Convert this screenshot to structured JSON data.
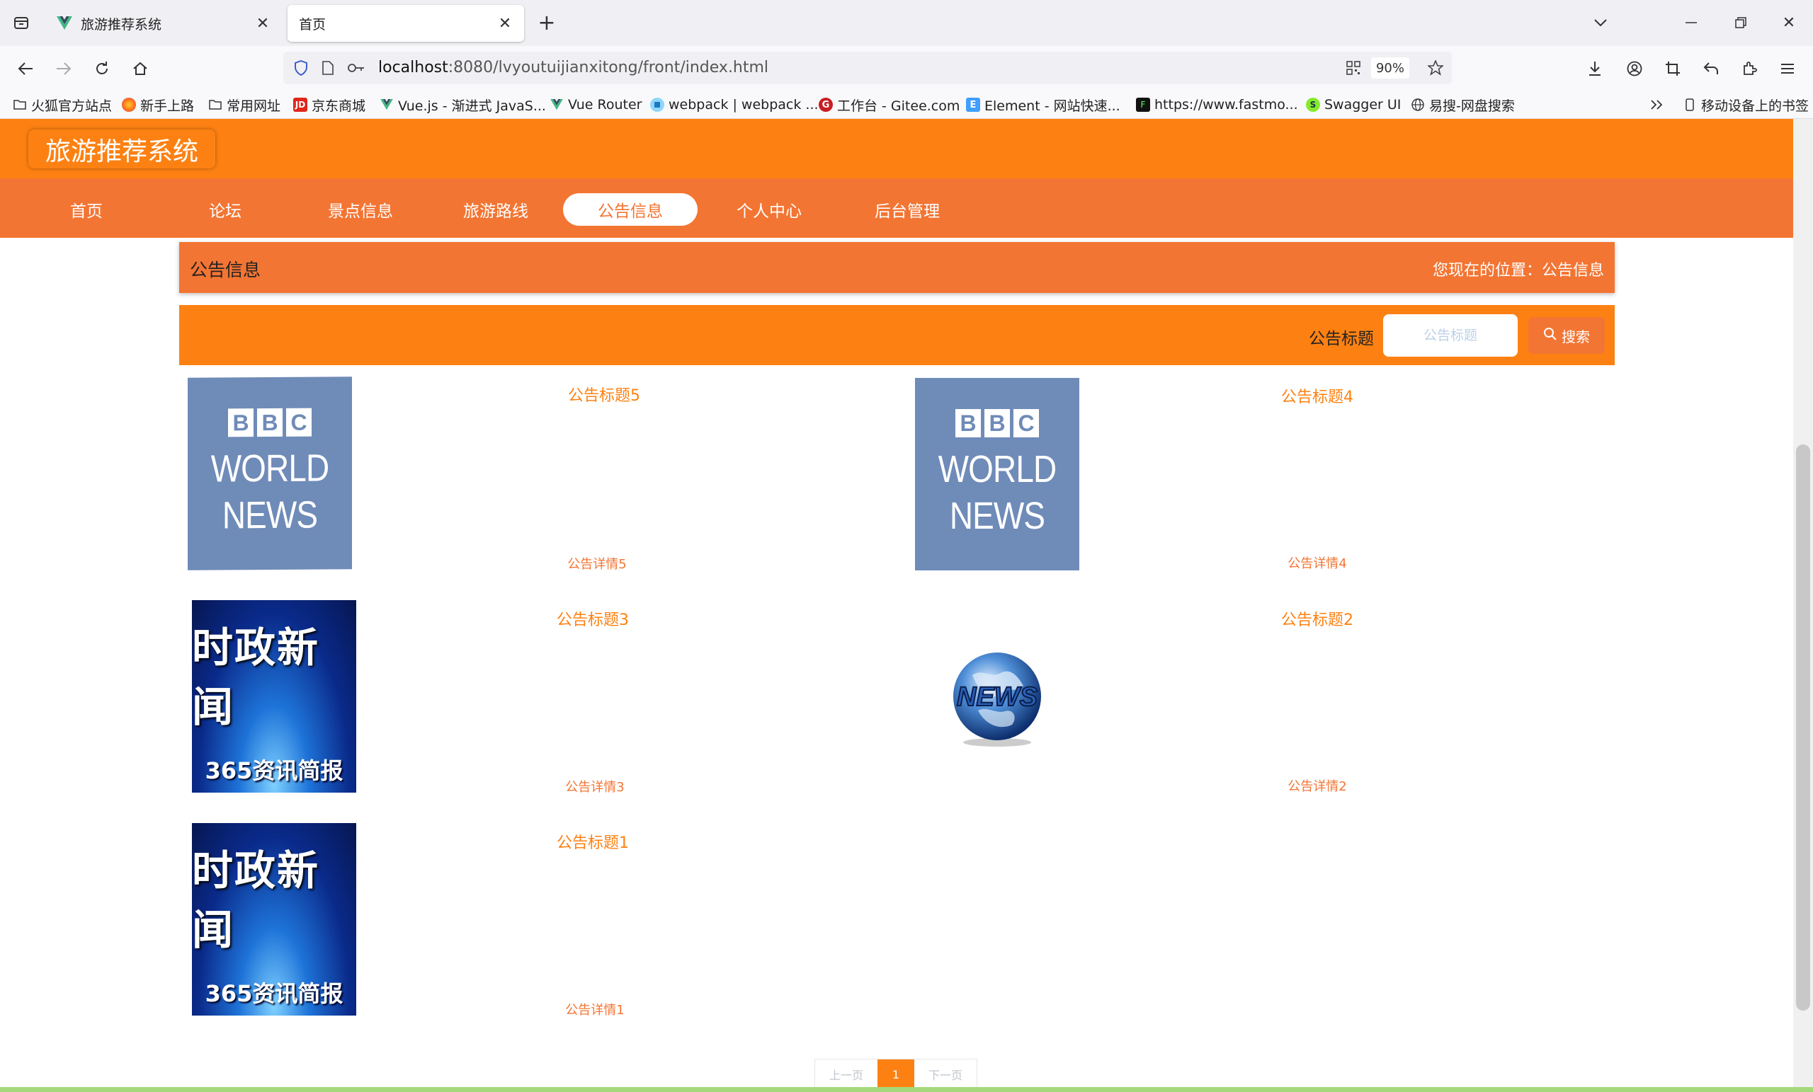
{
  "browser": {
    "tabs": [
      {
        "title": "旅游推荐系统",
        "active": false
      },
      {
        "title": "首页",
        "active": true
      }
    ],
    "url_host": "localhost",
    "url_rest": ":8080/lvyoutuijianxitong/front/index.html",
    "zoom": "90%",
    "bookmarks": [
      {
        "label": "火狐官方站点",
        "icon": "folder-icon"
      },
      {
        "label": "新手上路",
        "icon": "firefox-icon"
      },
      {
        "label": "常用网址",
        "icon": "folder-icon"
      },
      {
        "label": "京东商城",
        "icon": "jd-icon"
      },
      {
        "label": "Vue.js - 渐进式 JavaS...",
        "icon": "vue-icon"
      },
      {
        "label": "Vue Router",
        "icon": "vue-icon"
      },
      {
        "label": "webpack | webpack ...",
        "icon": "webpack-icon"
      },
      {
        "label": "工作台 - Gitee.com",
        "icon": "gitee-icon"
      },
      {
        "label": "Element - 网站快速...",
        "icon": "element-icon"
      },
      {
        "label": "https://www.fastmo...",
        "icon": "fastmock-icon"
      },
      {
        "label": "Swagger UI",
        "icon": "swagger-icon"
      },
      {
        "label": "易搜-网盘搜索",
        "icon": "globe-icon"
      }
    ],
    "mobile_bookmarks": "移动设备上的书签"
  },
  "site": {
    "logo": "旅游推荐系统",
    "nav": [
      "首页",
      "论坛",
      "景点信息",
      "旅游路线",
      "公告信息",
      "个人中心",
      "后台管理"
    ],
    "active_nav": "公告信息"
  },
  "breadcrumb": {
    "title": "公告信息",
    "location_label": "您现在的位置：",
    "location_value": "公告信息"
  },
  "search": {
    "label": "公告标题",
    "placeholder": "公告标题",
    "button": "搜索"
  },
  "notices": [
    {
      "title": "公告标题5",
      "detail": "公告详情5",
      "image": "bbc-world-news"
    },
    {
      "title": "公告标题4",
      "detail": "公告详情4",
      "image": "bbc-world-news"
    },
    {
      "title": "公告标题3",
      "detail": "公告详情3",
      "image": "shizheng-news"
    },
    {
      "title": "公告标题2",
      "detail": "公告详情2",
      "image": "news-globe"
    },
    {
      "title": "公告标题1",
      "detail": "公告详情1",
      "image": "shizheng-news"
    }
  ],
  "image_text": {
    "bbc_letters": [
      "B",
      "B",
      "C"
    ],
    "bbc_line1": "WORLD",
    "bbc_line2": "NEWS",
    "cn_main": "时政新闻",
    "cn_sub": "365资讯简报",
    "globe_text": "NEWS"
  },
  "pagination": {
    "prev": "上一页",
    "current": "1",
    "next": "下一页"
  },
  "colors": {
    "header_orange": "#fd8112",
    "nav_orange": "#f37533"
  }
}
